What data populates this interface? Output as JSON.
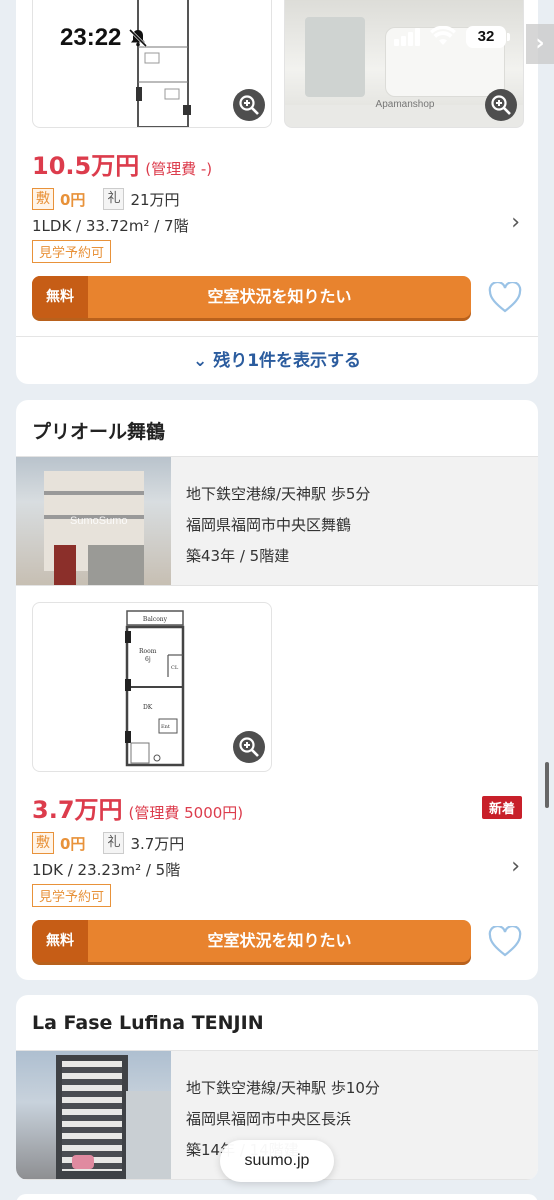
{
  "status_bar": {
    "time": "23:22",
    "battery": "32"
  },
  "listing1": {
    "photo_watermark": "Apamanshop",
    "rent": "10.5万円",
    "mgmt_fee": "(管理費 -)",
    "deposit_label": "敷",
    "deposit": "0円",
    "key_money_label": "礼",
    "key_money": "21万円",
    "spec": "1LDK / 33.72m² / 7階",
    "tour_badge": "見学予約可",
    "cta_free": "無料",
    "cta_label": "空室状況を知りたい",
    "show_more": "残り1件を表示する"
  },
  "property2": {
    "name": "プリオール舞鶴",
    "access": "地下鉄空港線/天神駅 歩5分",
    "address": "福岡県福岡市中央区舞鶴",
    "age": "築43年 / 5階建",
    "photo_watermark": "SumoSumo",
    "floorplan_labels": {
      "balcony": "Balcony",
      "room": "Room",
      "room_size": "6j",
      "cl": "CL",
      "dk": "DK",
      "ent": "Ent"
    },
    "rent": "3.7万円",
    "mgmt_fee": "(管理費 5000円)",
    "new_badge": "新着",
    "deposit_label": "敷",
    "deposit": "0円",
    "key_money_label": "礼",
    "key_money": "3.7万円",
    "spec": "1DK / 23.23m² / 5階",
    "tour_badge": "見学予約可",
    "cta_free": "無料",
    "cta_label": "空室状況を知りたい"
  },
  "property3": {
    "name": "La Fase Lufina TENJIN",
    "access": "地下鉄空港線/天神駅 歩10分",
    "address": "福岡県福岡市中央区長浜",
    "age": "築14年 / 14階建"
  },
  "url_bar": {
    "domain": "suumo.jp"
  },
  "colors": {
    "price": "#dc3c4c",
    "cta": "#e8832e",
    "link": "#2b5c9e",
    "new": "#c8202a"
  }
}
